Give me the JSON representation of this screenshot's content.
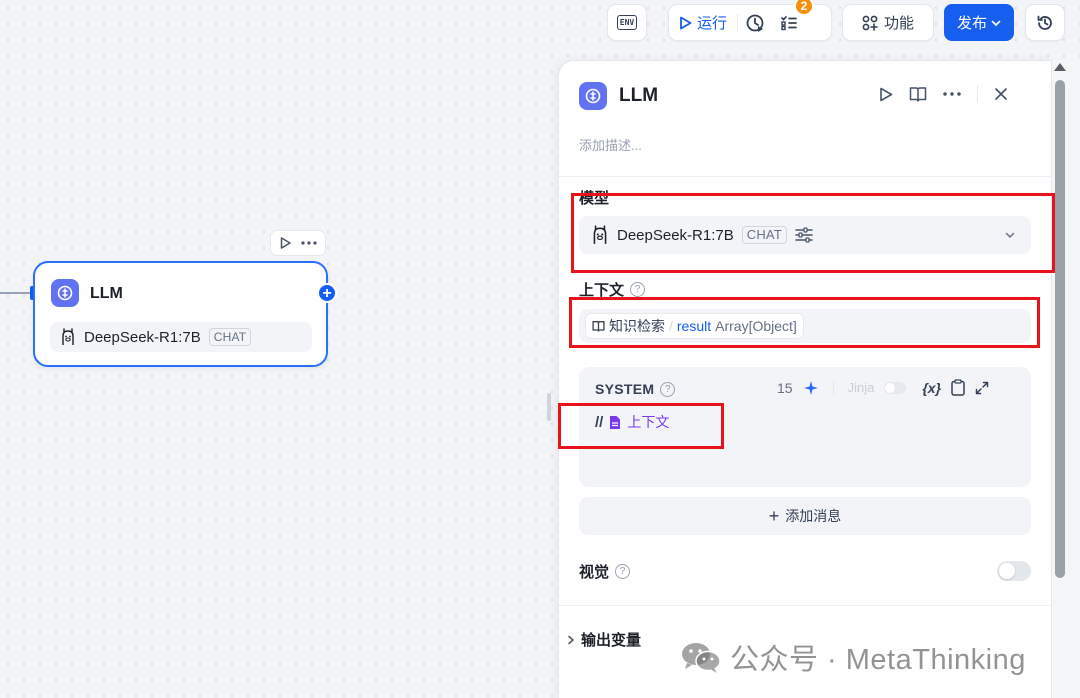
{
  "toolbar": {
    "env_label": "ENV",
    "run_label": "运行",
    "checklist_badge": "2",
    "features_label": "功能",
    "publish_label": "发布"
  },
  "canvas_node": {
    "title": "LLM",
    "model_name": "DeepSeek-R1:7B",
    "model_tag": "CHAT"
  },
  "panel": {
    "title": "LLM",
    "description_placeholder": "添加描述...",
    "model_section": {
      "label": "模型",
      "model_name": "DeepSeek-R1:7B",
      "model_tag": "CHAT"
    },
    "context_section": {
      "label": "上下文",
      "source_node": "知识检索",
      "separator": "/",
      "variable": "result",
      "variable_type": "Array[Object]"
    },
    "system_prompt": {
      "label": "SYSTEM",
      "token_count": "15",
      "jinja_label": "Jinja",
      "var_button": "{x}",
      "content_prefix": "//",
      "content_ref": "上下文"
    },
    "add_message_label": "添加消息",
    "vision_label": "视觉",
    "output_vars_label": "输出变量"
  },
  "watermark": {
    "text": "公众号 · MetaThinking"
  },
  "colors": {
    "primary": "#155eef",
    "node_icon": "#6172f3",
    "badge": "#f79009",
    "highlight": "#e8131b",
    "context_ref": "#7839ee"
  }
}
